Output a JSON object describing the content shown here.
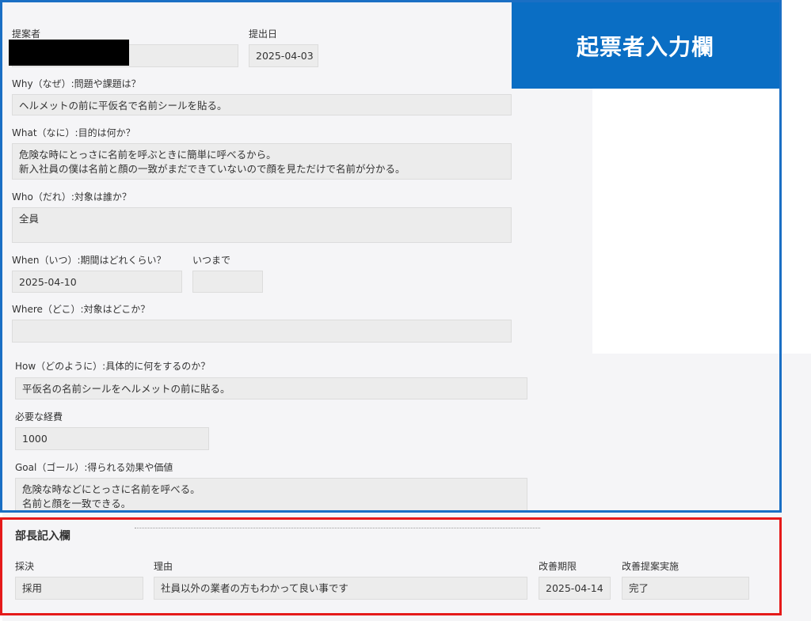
{
  "header": {
    "title": "起票者入力欄"
  },
  "proposer": {
    "label": "提案者",
    "value": ""
  },
  "submit_date": {
    "label": "提出日",
    "value": "2025-04-03"
  },
  "why": {
    "label": "Why（なぜ）:問題や課題は？",
    "value": "ヘルメットの前に平仮名で名前シールを貼る。"
  },
  "what": {
    "label": "What（なに）:目的は何か？",
    "value": "危険な時にとっさに名前を呼ぶときに簡単に呼べるから。\n新入社員の僕は名前と顔の一致がまだできていないので顔を見ただけで名前が分かる。"
  },
  "who": {
    "label": "Who（だれ）:対象は誰か？",
    "value": "全員"
  },
  "when": {
    "label": "When（いつ）:期間はどれくらい？",
    "value": "2025-04-10"
  },
  "until": {
    "label": "いつまで",
    "value": ""
  },
  "where": {
    "label": "Where（どこ）:対象はどこか？",
    "value": ""
  },
  "how": {
    "label": "How（どのように）:具体的に何をするのか？",
    "value": "平仮名の名前シールをヘルメットの前に貼る。"
  },
  "cost": {
    "label": "必要な経費",
    "value": "1000"
  },
  "goal": {
    "label": "Goal（ゴール）:得られる効果や価値",
    "value": "危険な時などにとっさに名前を呼べる。\n名前と顔を一致できる。"
  },
  "manager": {
    "title": "部長記入欄",
    "decision": {
      "label": "採決",
      "value": "採用"
    },
    "reason": {
      "label": "理由",
      "value": "社員以外の業者の方もわかって良い事です"
    },
    "deadline": {
      "label": "改善期限",
      "value": "2025-04-14"
    },
    "status": {
      "label": "改善提案実施",
      "value": "完了"
    }
  },
  "colors": {
    "header_blue": "#0a6ec4",
    "blue_border": "#1a6fc4",
    "red_border": "#e51a1a"
  }
}
